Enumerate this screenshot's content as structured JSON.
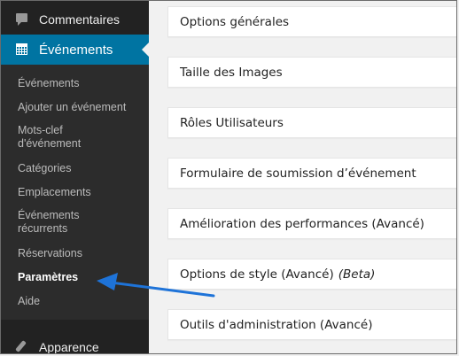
{
  "sidebar": {
    "comments_label": "Commentaires",
    "events_label": "Événements",
    "appearance_label": "Apparence",
    "submenu": [
      {
        "label": "Événements"
      },
      {
        "label": "Ajouter un événement"
      },
      {
        "label": "Mots-clef d'événement"
      },
      {
        "label": "Catégories"
      },
      {
        "label": "Emplacements"
      },
      {
        "label": "Événements récurrents"
      },
      {
        "label": "Réservations"
      },
      {
        "label": "Paramètres",
        "current": true
      },
      {
        "label": "Aide"
      }
    ]
  },
  "panels": [
    {
      "label": "Options générales"
    },
    {
      "label": "Taille des Images"
    },
    {
      "label": "Rôles Utilisateurs"
    },
    {
      "label": "Formulaire de soumission d’événement"
    },
    {
      "label": "Amélioration des performances (Avancé)"
    },
    {
      "label": "Options de style (Avancé)",
      "suffix": "(Beta)"
    },
    {
      "label": "Outils d'administration (Avancé)"
    }
  ],
  "colors": {
    "sidebar_bg": "#222222",
    "submenu_bg": "#2c2c2c",
    "active_menu": "#0074a2",
    "annotation_arrow": "#1e73d8"
  },
  "icons": {
    "comments": "comment-bubble-icon",
    "events": "calendar-icon",
    "appearance": "paintbrush-icon"
  }
}
